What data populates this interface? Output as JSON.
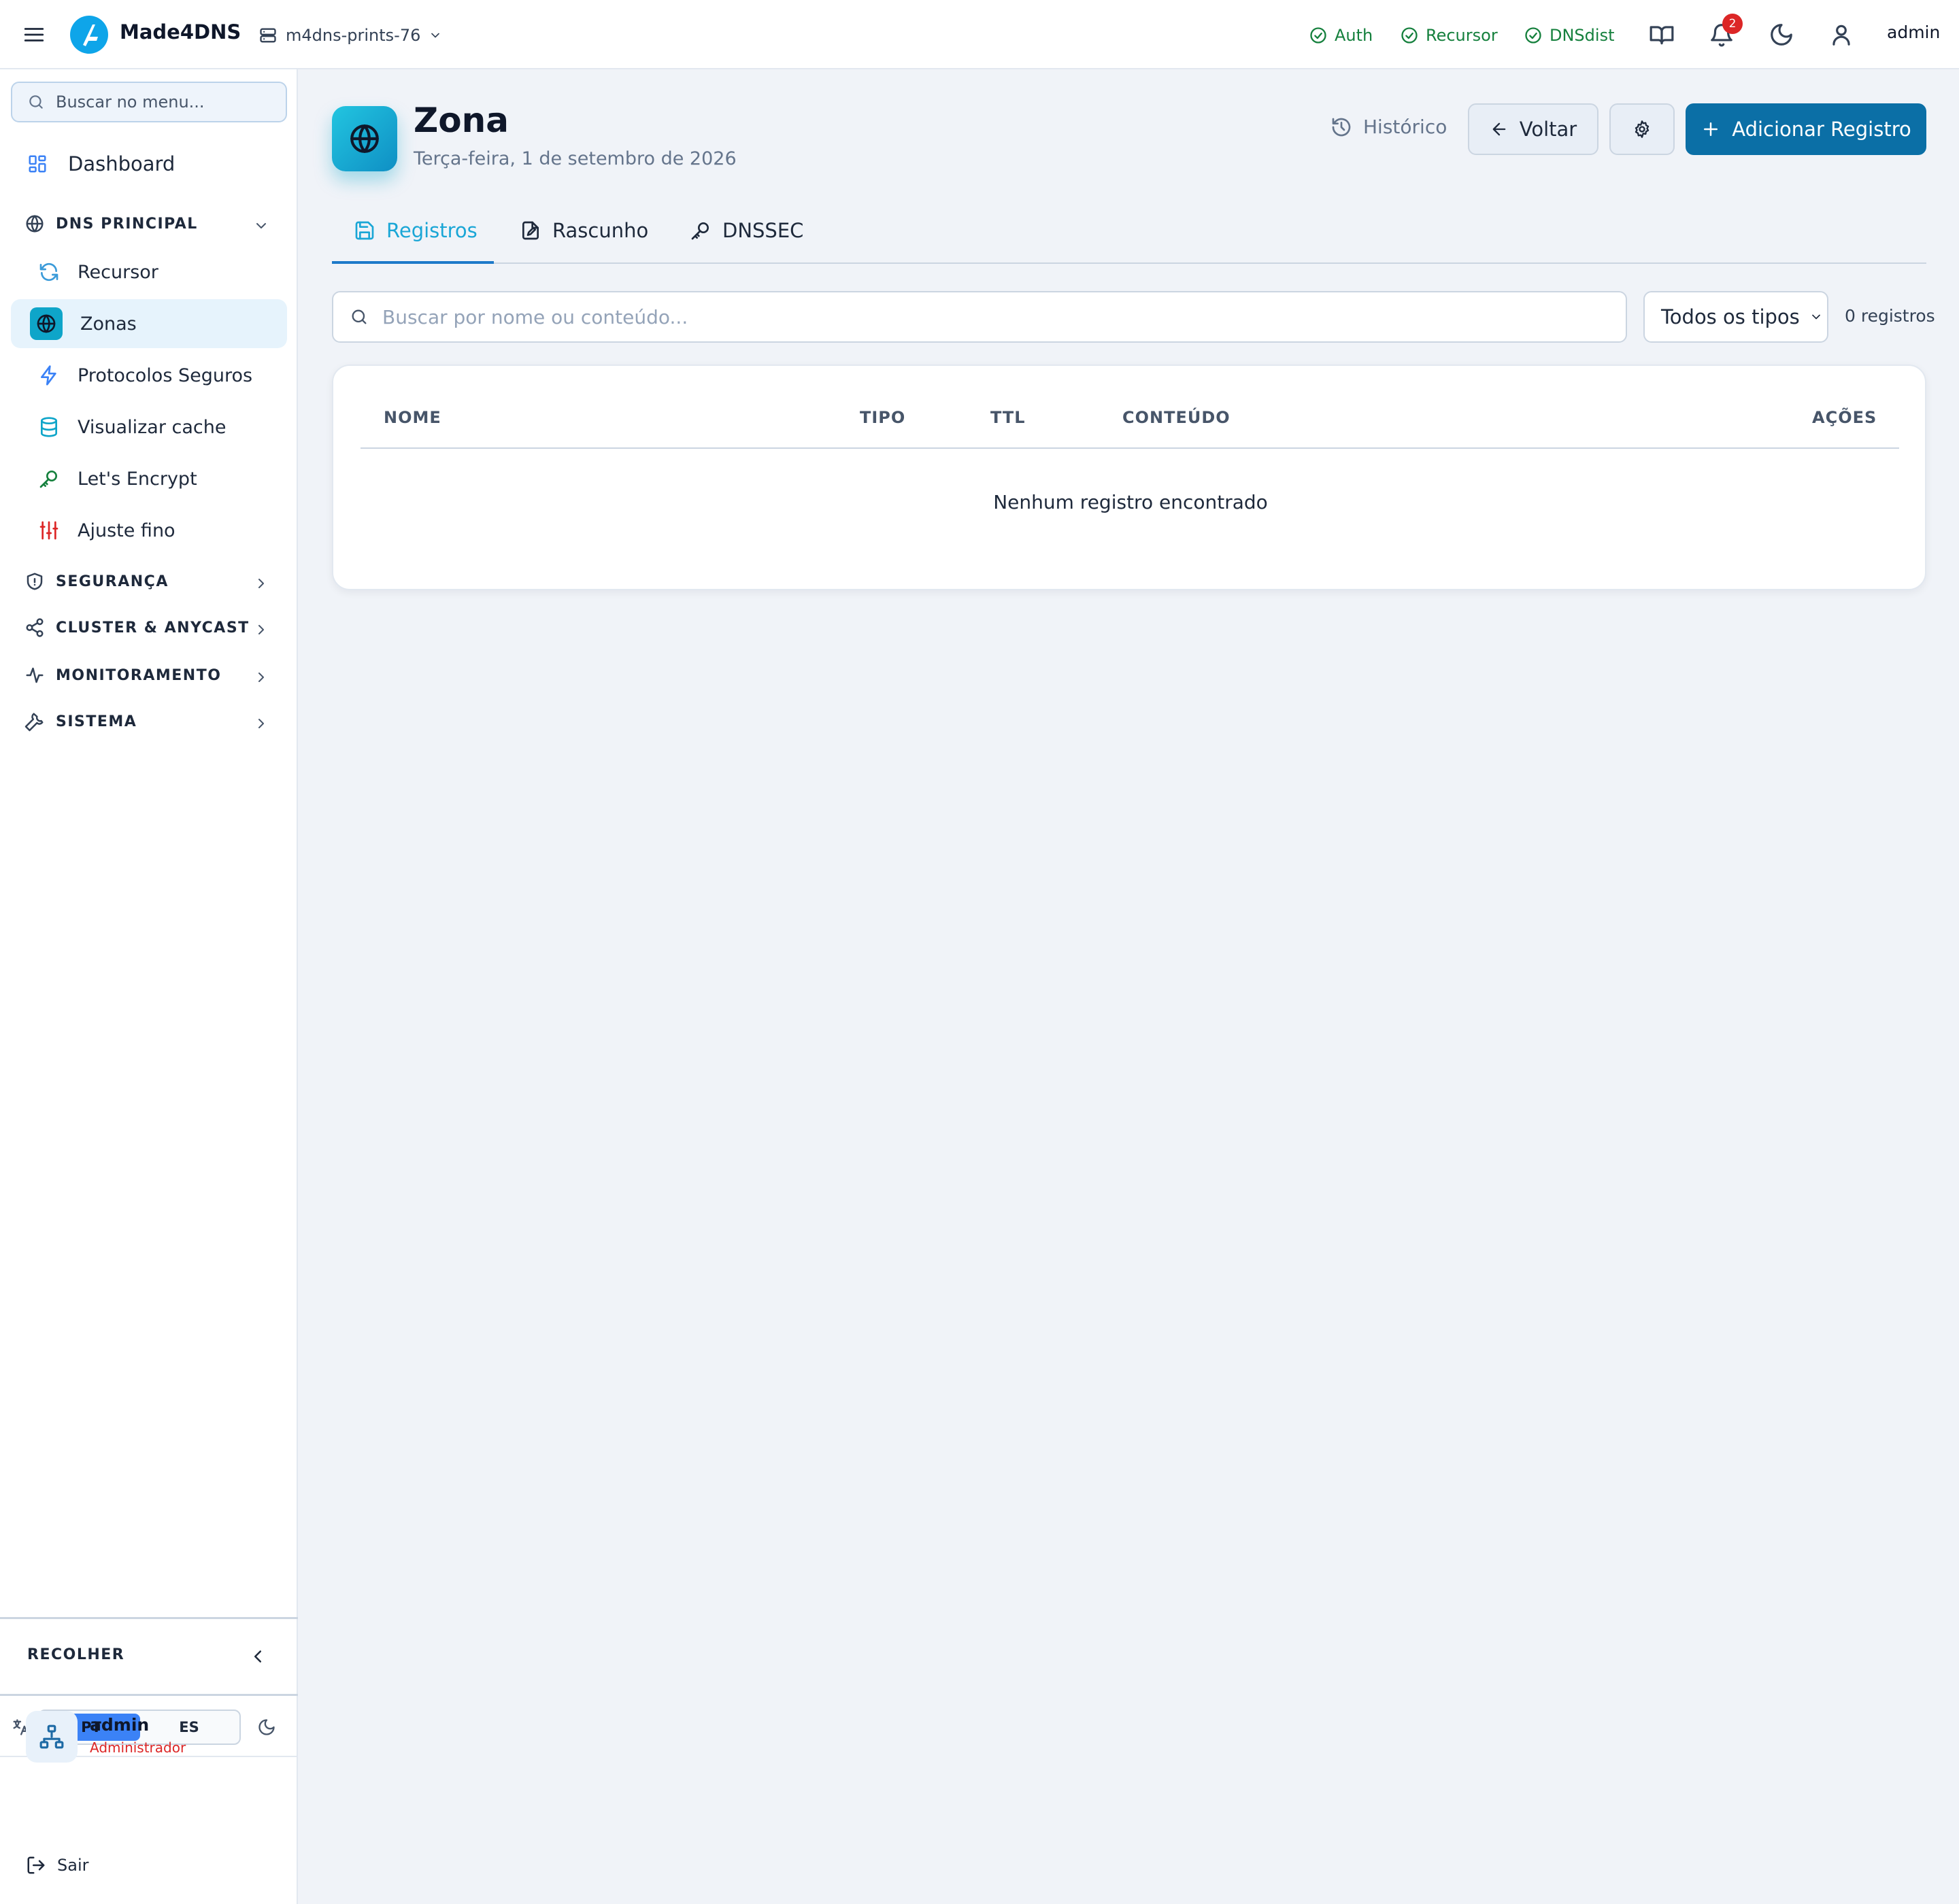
{
  "topbar": {
    "brand": "Made4DNS",
    "server": "m4dns-prints-76",
    "services": [
      "Auth",
      "Recursor",
      "DNSdist"
    ],
    "notification_count": "2",
    "user": "admin"
  },
  "sidebar": {
    "search_placeholder": "Buscar no menu...",
    "dashboard": "Dashboard",
    "sections": {
      "dns": "DNS PRINCIPAL",
      "security": "SEGURANÇA",
      "cluster": "CLUSTER & ANYCAST",
      "monitoring": "MONITORAMENTO",
      "system": "SISTEMA"
    },
    "items": [
      "Recursor",
      "Zonas",
      "Protocolos Seguros",
      "Visualizar cache",
      "Let's Encrypt",
      "Ajuste fino"
    ],
    "collapse": "RECOLHER",
    "lang": {
      "pt": "PT",
      "es": "ES"
    },
    "user": {
      "name": "admin",
      "role": "Administrador"
    },
    "logout": "Sair"
  },
  "page": {
    "title": "Zona",
    "date": "Terça-feira, 1 de setembro de 2026",
    "history": "Histórico",
    "back": "Voltar",
    "add": "Adicionar Registro"
  },
  "tabs": [
    "Registros",
    "Rascunho",
    "DNSSEC"
  ],
  "filters": {
    "search_placeholder": "Buscar por nome ou conteúdo...",
    "type": "Todos os tipos",
    "count": "0 registros"
  },
  "table": {
    "columns": [
      "NOME",
      "TIPO",
      "TTL",
      "CONTEÚDO",
      "AÇÕES"
    ],
    "rows": [],
    "empty": "Nenhum registro encontrado"
  },
  "colors": {
    "accent": "#0b6fa6",
    "active_tab": "#1aa6d6",
    "service_ok": "#15803d",
    "badge": "#dc2626",
    "role": "#dc2626"
  }
}
